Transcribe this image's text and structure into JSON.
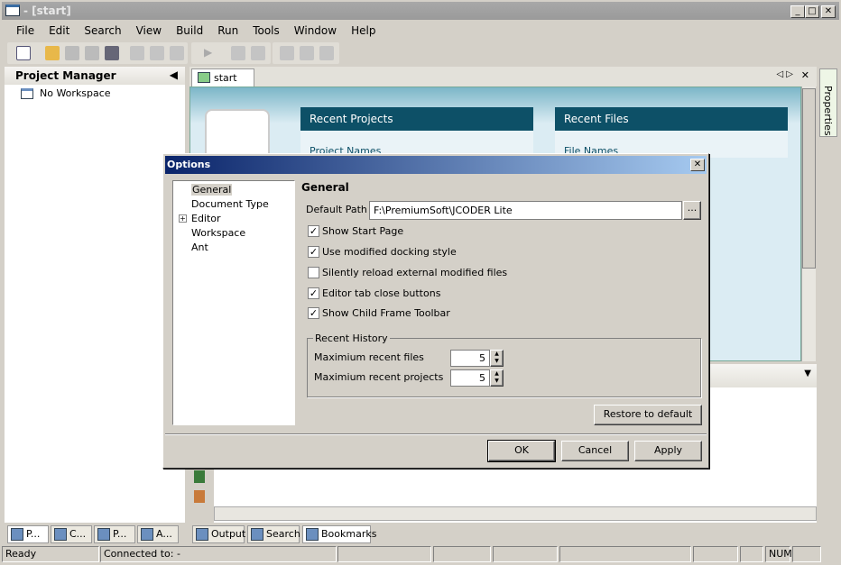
{
  "window": {
    "title": "- [start]",
    "controls": [
      "_",
      "□",
      "✕"
    ]
  },
  "menu": [
    "File",
    "Edit",
    "Search",
    "View",
    "Build",
    "Run",
    "Tools",
    "Window",
    "Help"
  ],
  "left_panel": {
    "title": "Project Manager",
    "tree_root": "No Workspace",
    "tabs": [
      "P...",
      "C...",
      "P...",
      "A..."
    ]
  },
  "editor": {
    "tab": "start",
    "recent_projects": {
      "title": "Recent Projects",
      "subtitle": "Project Names"
    },
    "recent_files": {
      "title": "Recent Files",
      "subtitle": "File Names"
    }
  },
  "right_panel": {
    "tab": "Properties"
  },
  "bottom_tabs": [
    "Output",
    "Search",
    "Bookmarks"
  ],
  "status": {
    "ready": "Ready",
    "connected": "Connected to: -",
    "num": "NUM"
  },
  "dialog": {
    "title": "Options",
    "tree": [
      "General",
      "Document Type",
      "Editor",
      "Workspace",
      "Ant"
    ],
    "heading": "General",
    "default_path_label": "Default Path",
    "default_path": "F:\\PremiumSoft\\JCODER Lite",
    "browse": "...",
    "checkboxes": [
      {
        "label": "Show Start Page",
        "checked": true
      },
      {
        "label": "Use modified docking style",
        "checked": true
      },
      {
        "label": "Silently reload external modified files",
        "checked": false
      },
      {
        "label": "Editor tab close buttons",
        "checked": true
      },
      {
        "label": "Show Child Frame Toolbar",
        "checked": true
      }
    ],
    "history": {
      "title": "Recent History",
      "files_label": "Maximium recent files",
      "files": "5",
      "projects_label": "Maximium recent projects",
      "projects": "5"
    },
    "restore": "Restore to default",
    "ok": "OK",
    "cancel": "Cancel",
    "apply": "Apply"
  }
}
